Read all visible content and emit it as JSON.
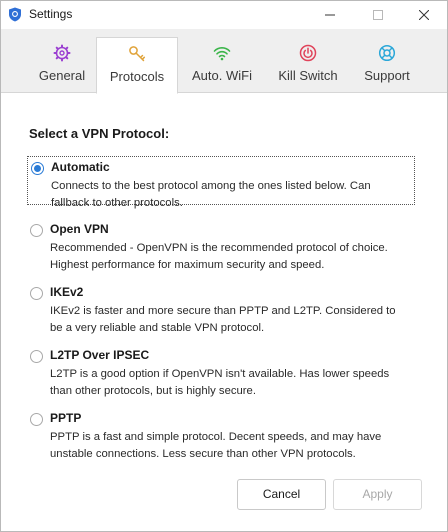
{
  "window": {
    "title": "Settings"
  },
  "tabs": [
    {
      "label": "General",
      "icon": "gear-icon",
      "color": "#9b3fd1",
      "active": false
    },
    {
      "label": "Protocols",
      "icon": "key-icon",
      "color": "#e0a33a",
      "active": true
    },
    {
      "label": "Auto. WiFi",
      "icon": "wifi-icon",
      "color": "#3bb54a",
      "active": false
    },
    {
      "label": "Kill Switch",
      "icon": "power-icon",
      "color": "#e0435a",
      "active": false
    },
    {
      "label": "Support",
      "icon": "lifebuoy-icon",
      "color": "#2aa7d8",
      "active": false
    }
  ],
  "main": {
    "section_title": "Select a VPN Protocol:",
    "options": [
      {
        "name": "Automatic",
        "description": "Connects to the best protocol among the ones listed below. Can fallback to other protocols.",
        "checked": true
      },
      {
        "name": "Open VPN",
        "description": "Recommended - OpenVPN is the recommended protocol of choice. Highest performance for maximum security and speed.",
        "checked": false
      },
      {
        "name": "IKEv2",
        "description": "IKEv2 is faster and more secure than PPTP and L2TP. Considered to be a very reliable and stable VPN protocol.",
        "checked": false
      },
      {
        "name": "L2TP Over IPSEC",
        "description": "L2TP is a good option if OpenVPN isn't available. Has lower speeds than other protocols, but is highly secure.",
        "checked": false
      },
      {
        "name": "PPTP",
        "description": "PPTP is a fast and simple protocol. Decent speeds, and may have unstable connections. Less secure than other VPN protocols.",
        "checked": false
      }
    ]
  },
  "footer": {
    "cancel_label": "Cancel",
    "apply_label": "Apply"
  }
}
